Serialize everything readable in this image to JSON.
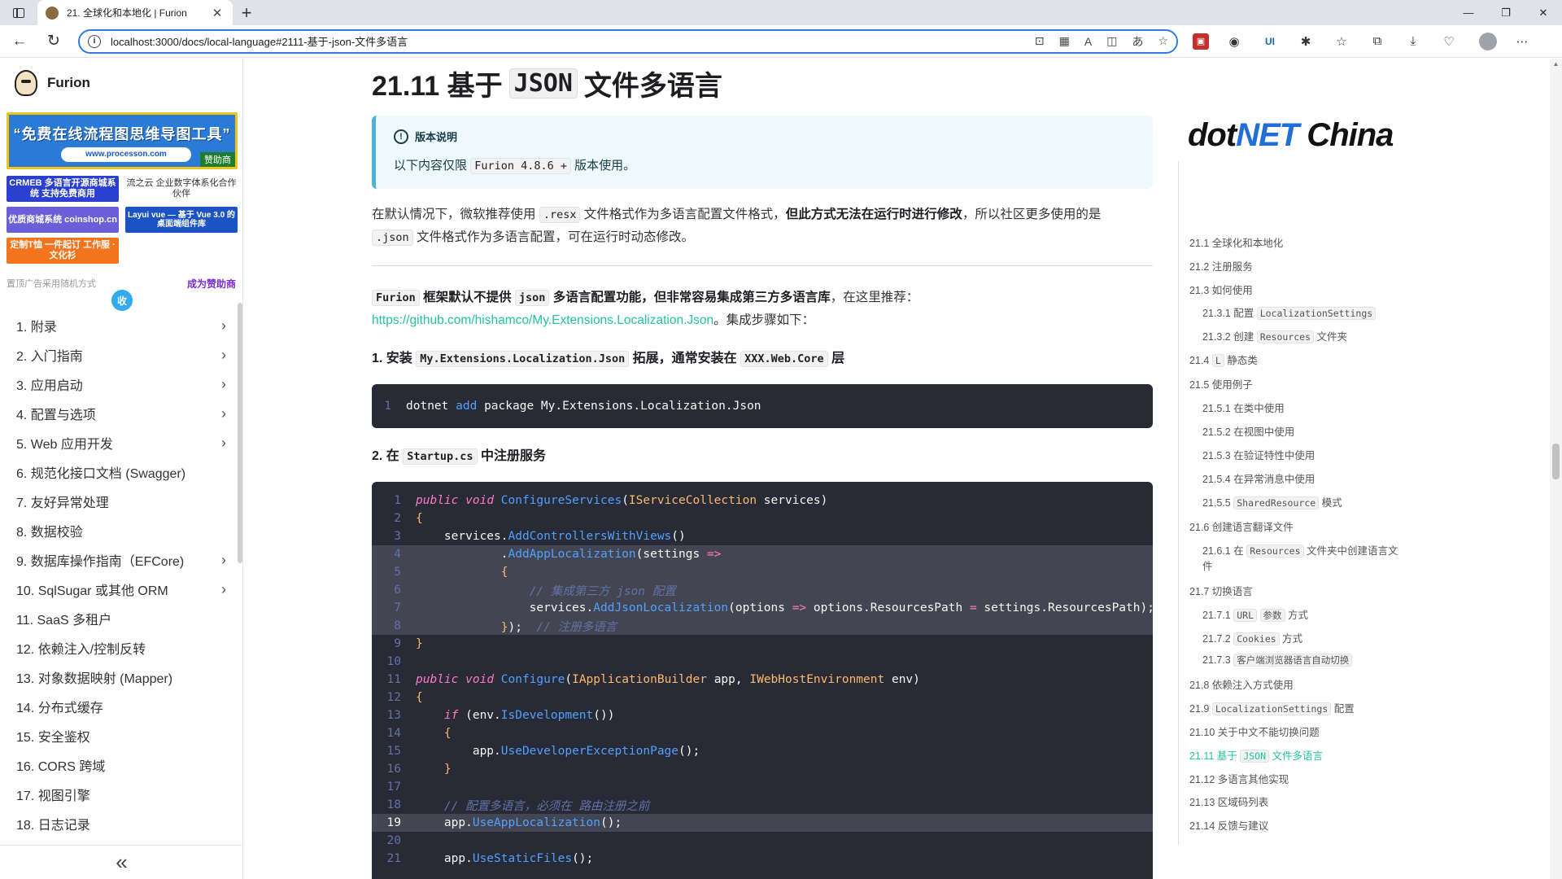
{
  "browser": {
    "tab_title": "21. 全球化和本地化 | Furion",
    "tab_close": "✕",
    "new_tab": "+",
    "url": "localhost:3000/docs/local-language#2111-基于-json-文件多语言",
    "win_min": "—",
    "win_restore": "❐",
    "win_close": "✕"
  },
  "sidebar": {
    "brand": "Furion",
    "ad_main_text": "“免费在线流程图思维导图工具”",
    "ad_main_url": "www.processon.com",
    "ad_main_tag": "赞助商",
    "ad_small": [
      {
        "text": "CRMEB 多语言开源商城系统 支持免费商用",
        "color": "#2b3fd1"
      },
      {
        "text": "流之云 企业数字体系化合作伙伴",
        "color": "#ffffff"
      },
      {
        "text": "优质商城系统 coinshop.cn",
        "color": "#6a5fd8"
      },
      {
        "text": "Layui vue — 基于 Vue 3.0 的桌面端组件库",
        "color": "#1b52c4"
      },
      {
        "text": "定制T恤 一件起订 工作服 · 文化衫",
        "color": "#f2741c"
      }
    ],
    "ad_note": "置顶广告采用随机方式",
    "ad_join": "成为赞助商",
    "collapse_label": "收",
    "menu": [
      {
        "label": "1. 附录",
        "chevron": true
      },
      {
        "label": "2. 入门指南",
        "chevron": true
      },
      {
        "label": "3. 应用启动",
        "chevron": true
      },
      {
        "label": "4. 配置与选项",
        "chevron": true
      },
      {
        "label": "5. Web 应用开发",
        "chevron": true
      },
      {
        "label": "6. 规范化接口文档 (Swagger)",
        "chevron": false
      },
      {
        "label": "7. 友好异常处理",
        "chevron": false
      },
      {
        "label": "8. 数据校验",
        "chevron": false
      },
      {
        "label": "9. 数据库操作指南（EFCore)",
        "chevron": true
      },
      {
        "label": "10. SqlSugar 或其他 ORM",
        "chevron": true
      },
      {
        "label": "11. SaaS 多租户",
        "chevron": false
      },
      {
        "label": "12. 依赖注入/控制反转",
        "chevron": false
      },
      {
        "label": "13. 对象数据映射 (Mapper)",
        "chevron": false
      },
      {
        "label": "14. 分布式缓存",
        "chevron": false
      },
      {
        "label": "15. 安全鉴权",
        "chevron": false
      },
      {
        "label": "16. CORS 跨域",
        "chevron": false
      },
      {
        "label": "17. 视图引擎",
        "chevron": false
      },
      {
        "label": "18. 日志记录",
        "chevron": false
      }
    ],
    "bottom_collapse": "«"
  },
  "content": {
    "title_prefix": "21.11 基于",
    "title_code": "JSON",
    "title_suffix": "文件多语言",
    "admon_title": "版本说明",
    "admon_text_a": "以下内容仅限",
    "admon_code": "Furion 4.8.6 +",
    "admon_text_b": "版本使用。",
    "p1_a": "在默认情况下，微软推荐使用",
    "p1_code1": ".resx",
    "p1_b": "文件格式作为多语言配置文件格式，",
    "p1_bold": "但此方式无法在运行时进行修改",
    "p1_c": "，所以社区更多使用的是",
    "p1_code2": ".json",
    "p1_d": "文件格式作为多语言配置，可在运行时动态修改。",
    "p2_code1": "Furion",
    "p2_bold_a": "框架默认不提供",
    "p2_code2": "json",
    "p2_bold_b": "多语言配置功能，但非常容易集成第三方多语言库",
    "p2_a": "，在这里推荐：",
    "p2_link": "https://github.com/hishamco/My.Extensions.Localization.Json",
    "p2_b": "。集成步骤如下：",
    "step1_a": "1. 安装",
    "step1_code": "My.Extensions.Localization.Json",
    "step1_b": "拓展，通常安装在",
    "step1_code2": "XXX.Web.Core",
    "step1_c": "层",
    "code1_ln": "1",
    "code1_cmd": "dotnet",
    "code1_add": "add",
    "code1_rest": "package My.Extensions.Localization.Json",
    "step2_a": "2. 在",
    "step2_code": "Startup.cs",
    "step2_b": "中注册服务"
  },
  "code_lines": [
    {
      "n": "1",
      "hl": false,
      "html": "<span class='k'>public</span> <span class='k'>void</span> <span class='fn'>ConfigureServices</span>(<span class='ty'>IServiceCollection</span> services)"
    },
    {
      "n": "2",
      "hl": false,
      "html": "<span class='ty'>{</span>"
    },
    {
      "n": "3",
      "hl": false,
      "html": "    services.<span class='fn'>AddControllersWithViews</span>()"
    },
    {
      "n": "4",
      "hl": true,
      "html": "            .<span class='fn'>AddAppLocalization</span>(settings <span class='op'>=></span>"
    },
    {
      "n": "5",
      "hl": true,
      "html": "            <span class='ty'>{</span>"
    },
    {
      "n": "6",
      "hl": true,
      "html": "                <span class='cm'>// 集成第三方 json 配置</span>"
    },
    {
      "n": "7",
      "hl": true,
      "html": "                services.<span class='fn'>AddJsonLocalization</span>(options <span class='op'>=></span> options.ResourcesPath <span class='op'>=</span> settings.ResourcesPath);"
    },
    {
      "n": "8",
      "hl": true,
      "html": "            <span class='ty'>}</span>);  <span class='cm'>// 注册多语言</span>"
    },
    {
      "n": "9",
      "hl": false,
      "html": "<span class='ty'>}</span>"
    },
    {
      "n": "10",
      "hl": false,
      "html": ""
    },
    {
      "n": "11",
      "hl": false,
      "html": "<span class='k'>public</span> <span class='k'>void</span> <span class='fn'>Configure</span>(<span class='ty'>IApplicationBuilder</span> app, <span class='ty'>IWebHostEnvironment</span> env)"
    },
    {
      "n": "12",
      "hl": false,
      "html": "<span class='ty'>{</span>"
    },
    {
      "n": "13",
      "hl": false,
      "html": "    <span class='k'>if</span> (env.<span class='fn'>IsDevelopment</span>())"
    },
    {
      "n": "14",
      "hl": false,
      "html": "    <span class='ty'>{</span>"
    },
    {
      "n": "15",
      "hl": false,
      "html": "        app.<span class='fn'>UseDeveloperExceptionPage</span>();"
    },
    {
      "n": "16",
      "hl": false,
      "html": "    <span class='ty'>}</span>"
    },
    {
      "n": "17",
      "hl": false,
      "html": ""
    },
    {
      "n": "18",
      "hl": false,
      "html": "    <span class='cm'>// 配置多语言，必须在 路由注册之前</span>"
    },
    {
      "n": "19",
      "hl": true,
      "act": true,
      "html": "    app.<span class='fn'>UseAppLocalization</span>();"
    },
    {
      "n": "20",
      "hl": false,
      "html": ""
    },
    {
      "n": "21",
      "hl": false,
      "html": "    app.<span class='fn'>UseStaticFiles</span>();"
    }
  ],
  "toc": {
    "logo_a": "dot",
    "logo_b": "NET",
    "logo_c": " China",
    "items": [
      {
        "text": "21.1 全球化和本地化",
        "lvl": 1
      },
      {
        "text": "21.2 注册服务",
        "lvl": 1
      },
      {
        "text": "21.3 如何使用",
        "lvl": 1
      },
      {
        "text": "21.3.1 配置 ",
        "code": "LocalizationSettings",
        "lvl": 2
      },
      {
        "text": "21.3.2 创建 ",
        "code": "Resources",
        "after": " 文件夹",
        "lvl": 2
      },
      {
        "text": "21.4 ",
        "code": "L",
        "after": " 静态类",
        "lvl": 1
      },
      {
        "text": "21.5 使用例子",
        "lvl": 1
      },
      {
        "text": "21.5.1 在类中使用",
        "lvl": 2
      },
      {
        "text": "21.5.2 在视图中使用",
        "lvl": 2
      },
      {
        "text": "21.5.3 在验证特性中使用",
        "lvl": 2
      },
      {
        "text": "21.5.4 在异常消息中使用",
        "lvl": 2
      },
      {
        "text": "21.5.5 ",
        "code": "SharedResource",
        "after": " 模式",
        "lvl": 2
      },
      {
        "text": "21.6 创建语言翻译文件",
        "lvl": 1
      },
      {
        "text": "21.6.1 在 ",
        "code": "Resources",
        "after": " 文件夹中创建语言文",
        "lvl": 2,
        "wrap": "件"
      },
      {
        "text": "21.7 切换语言",
        "lvl": 1
      },
      {
        "text": "21.7.1 ",
        "code": "URL",
        "mid": " ",
        "code2": "参数",
        "after": " 方式",
        "lvl": 2
      },
      {
        "text": "21.7.2 ",
        "code": "Cookies",
        "after": " 方式",
        "lvl": 2
      },
      {
        "text": "21.7.3 ",
        "code": "客户端浏览器语言自动切换",
        "lvl": 2
      },
      {
        "text": "21.8 依赖注入方式使用",
        "lvl": 1
      },
      {
        "text": "21.9 ",
        "code": "LocalizationSettings",
        "after": " 配置",
        "lvl": 1
      },
      {
        "text": "21.10 关于中文不能切换问题",
        "lvl": 1
      },
      {
        "text": "21.11 基于 ",
        "code": "JSON",
        "after": " 文件多语言",
        "lvl": 1,
        "active": true
      },
      {
        "text": "21.12 多语言其他实现",
        "lvl": 1
      },
      {
        "text": "21.13 区域码列表",
        "lvl": 1
      },
      {
        "text": "21.14 反馈与建议",
        "lvl": 1
      }
    ]
  },
  "colors": {
    "accent": "#25c2a0",
    "admon_border": "#4cb3d4",
    "code_bg": "#282a36"
  }
}
